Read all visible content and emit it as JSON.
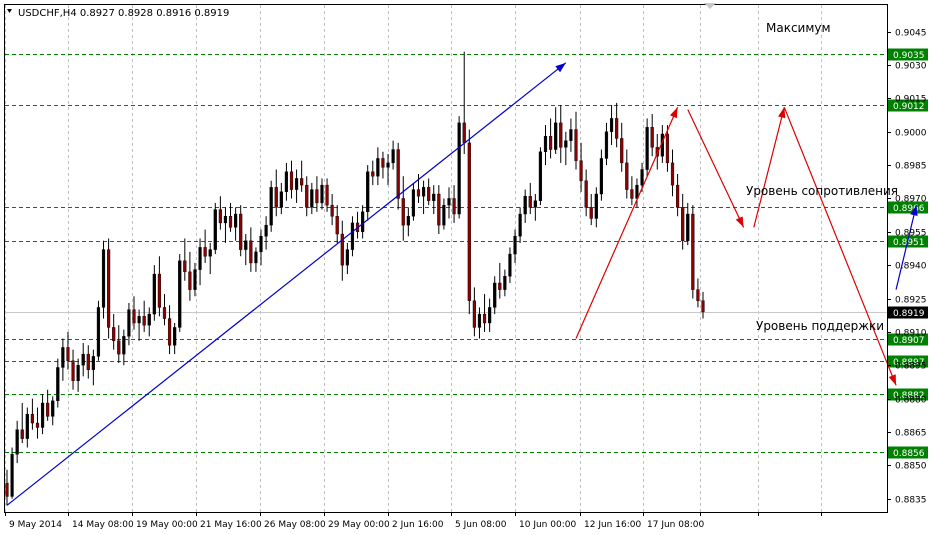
{
  "header": {
    "symbol_text": "USDCHF,H4  0.8927 0.8928 0.8916 0.8919"
  },
  "chart_data": {
    "type": "candlestick",
    "ylim": [
      0.8829,
      0.9057
    ],
    "yticks": [
      "0.9045",
      "0.9030",
      "0.9015",
      "0.9000",
      "0.8985",
      "0.8970",
      "0.8955",
      "0.8940",
      "0.8925",
      "0.8910",
      "0.8895",
      "0.8880",
      "0.8865",
      "0.8850",
      "0.8835"
    ],
    "xticks": [
      "9 May 2014",
      "14 May 08:00",
      "19 May 00:00",
      "21 May 16:00",
      "26 May 08:00",
      "29 May 00:00",
      "2 Jun 16:00",
      "5 Jun 08:00",
      "10 Jun 00:00",
      "12 Jun 16:00",
      "17 Jun 08:00"
    ],
    "levels": [
      {
        "value": "0.9035",
        "hl": false
      },
      {
        "value": "0.9012",
        "hl": true
      },
      {
        "value": "0.8966",
        "hl": false
      },
      {
        "value": "0.8951",
        "hl": true
      },
      {
        "value": "0.8907",
        "hl": true
      },
      {
        "value": "0.8897",
        "hl": false
      },
      {
        "value": "0.8882",
        "hl": false
      },
      {
        "value": "0.8856",
        "hl": false
      }
    ],
    "current_price": "0.8919",
    "annotations": [
      "Максимум",
      "Уровень сопротивления",
      "Уровень поддержки"
    ],
    "colors": {
      "bull": "#000000",
      "bear": "#8b0000",
      "level_line": "#008000",
      "level_tag": "#008000",
      "trend_blue": "#0000cc",
      "trend_red": "#dd0000",
      "grid": "#c0c0c0"
    },
    "ohlc": [
      [
        0.8842,
        0.8848,
        0.8832,
        0.8836
      ],
      [
        0.8836,
        0.8858,
        0.8835,
        0.8855
      ],
      [
        0.8855,
        0.887,
        0.8851,
        0.8866
      ],
      [
        0.8866,
        0.8878,
        0.886,
        0.8862
      ],
      [
        0.8862,
        0.8876,
        0.8858,
        0.8873
      ],
      [
        0.8873,
        0.888,
        0.8866,
        0.8869
      ],
      [
        0.8869,
        0.8876,
        0.8862,
        0.8867
      ],
      [
        0.8867,
        0.8882,
        0.8864,
        0.8878
      ],
      [
        0.8878,
        0.8884,
        0.887,
        0.8872
      ],
      [
        0.8872,
        0.8881,
        0.8868,
        0.8879
      ],
      [
        0.8879,
        0.8898,
        0.8876,
        0.8894
      ],
      [
        0.8894,
        0.8907,
        0.8888,
        0.8903
      ],
      [
        0.8903,
        0.891,
        0.8893,
        0.8897
      ],
      [
        0.8897,
        0.8902,
        0.8884,
        0.8888
      ],
      [
        0.8888,
        0.8898,
        0.8883,
        0.8895
      ],
      [
        0.8895,
        0.8905,
        0.889,
        0.89
      ],
      [
        0.89,
        0.8904,
        0.8889,
        0.8893
      ],
      [
        0.8893,
        0.8902,
        0.8886,
        0.8899
      ],
      [
        0.8899,
        0.8924,
        0.8897,
        0.8921
      ],
      [
        0.8921,
        0.8951,
        0.8916,
        0.8947
      ],
      [
        0.8947,
        0.8952,
        0.8907,
        0.8912
      ],
      [
        0.8912,
        0.8918,
        0.8902,
        0.8906
      ],
      [
        0.8906,
        0.8913,
        0.8896,
        0.89
      ],
      [
        0.89,
        0.8911,
        0.8895,
        0.8908
      ],
      [
        0.8908,
        0.8923,
        0.8904,
        0.892
      ],
      [
        0.892,
        0.8926,
        0.8911,
        0.8914
      ],
      [
        0.8914,
        0.892,
        0.8906,
        0.8917
      ],
      [
        0.8917,
        0.8924,
        0.891,
        0.8913
      ],
      [
        0.8913,
        0.8921,
        0.8908,
        0.8918
      ],
      [
        0.8918,
        0.894,
        0.8915,
        0.8936
      ],
      [
        0.8936,
        0.8944,
        0.8917,
        0.8921
      ],
      [
        0.8921,
        0.8927,
        0.8913,
        0.8916
      ],
      [
        0.8916,
        0.8922,
        0.89,
        0.8904
      ],
      [
        0.8904,
        0.8914,
        0.89,
        0.8912
      ],
      [
        0.8912,
        0.8945,
        0.891,
        0.8942
      ],
      [
        0.8942,
        0.8952,
        0.8933,
        0.8937
      ],
      [
        0.8937,
        0.8946,
        0.8924,
        0.8929
      ],
      [
        0.8929,
        0.8941,
        0.8926,
        0.8938
      ],
      [
        0.8938,
        0.8952,
        0.8931,
        0.8948
      ],
      [
        0.8948,
        0.8956,
        0.8941,
        0.8944
      ],
      [
        0.8944,
        0.895,
        0.8936,
        0.8947
      ],
      [
        0.8947,
        0.8968,
        0.8945,
        0.8965
      ],
      [
        0.8965,
        0.8971,
        0.8956,
        0.8959
      ],
      [
        0.8959,
        0.8966,
        0.895,
        0.8962
      ],
      [
        0.8962,
        0.8968,
        0.8955,
        0.8957
      ],
      [
        0.8957,
        0.8966,
        0.8951,
        0.8963
      ],
      [
        0.8963,
        0.8967,
        0.8944,
        0.8947
      ],
      [
        0.8947,
        0.8954,
        0.894,
        0.8951
      ],
      [
        0.8951,
        0.8957,
        0.8937,
        0.8941
      ],
      [
        0.8941,
        0.8948,
        0.8937,
        0.8946
      ],
      [
        0.8946,
        0.8956,
        0.894,
        0.8953
      ],
      [
        0.8953,
        0.8962,
        0.8947,
        0.8958
      ],
      [
        0.8958,
        0.8978,
        0.8955,
        0.8975
      ],
      [
        0.8975,
        0.8983,
        0.8962,
        0.8966
      ],
      [
        0.8966,
        0.8977,
        0.8963,
        0.8973
      ],
      [
        0.8973,
        0.8986,
        0.8969,
        0.8982
      ],
      [
        0.8982,
        0.8987,
        0.897,
        0.8974
      ],
      [
        0.8974,
        0.8983,
        0.8968,
        0.8979
      ],
      [
        0.8979,
        0.8987,
        0.8973,
        0.8976
      ],
      [
        0.8976,
        0.898,
        0.8962,
        0.8966
      ],
      [
        0.8966,
        0.8977,
        0.8963,
        0.8974
      ],
      [
        0.8974,
        0.898,
        0.8964,
        0.8968
      ],
      [
        0.8968,
        0.8979,
        0.8965,
        0.8976
      ],
      [
        0.8976,
        0.8979,
        0.8964,
        0.8967
      ],
      [
        0.8967,
        0.8972,
        0.8958,
        0.8962
      ],
      [
        0.8962,
        0.8967,
        0.895,
        0.8954
      ],
      [
        0.8954,
        0.896,
        0.8933,
        0.894
      ],
      [
        0.894,
        0.895,
        0.8936,
        0.8947
      ],
      [
        0.8947,
        0.8962,
        0.8944,
        0.8959
      ],
      [
        0.8959,
        0.8964,
        0.8952,
        0.8955
      ],
      [
        0.8955,
        0.8967,
        0.8952,
        0.8964
      ],
      [
        0.8964,
        0.8985,
        0.896,
        0.8982
      ],
      [
        0.8982,
        0.8987,
        0.8976,
        0.898
      ],
      [
        0.898,
        0.8993,
        0.8976,
        0.8988
      ],
      [
        0.8988,
        0.8991,
        0.8979,
        0.8984
      ],
      [
        0.8984,
        0.899,
        0.8976,
        0.8986
      ],
      [
        0.8986,
        0.8996,
        0.8983,
        0.8992
      ],
      [
        0.8992,
        0.8995,
        0.8965,
        0.897
      ],
      [
        0.897,
        0.898,
        0.8951,
        0.8958
      ],
      [
        0.8958,
        0.8966,
        0.8953,
        0.8962
      ],
      [
        0.8962,
        0.8977,
        0.896,
        0.8974
      ],
      [
        0.8974,
        0.8981,
        0.8968,
        0.8971
      ],
      [
        0.8971,
        0.8978,
        0.8963,
        0.8975
      ],
      [
        0.8975,
        0.8979,
        0.8967,
        0.8969
      ],
      [
        0.8969,
        0.8976,
        0.8963,
        0.8972
      ],
      [
        0.8972,
        0.8976,
        0.8954,
        0.8958
      ],
      [
        0.8958,
        0.897,
        0.8956,
        0.8967
      ],
      [
        0.8967,
        0.8975,
        0.8961,
        0.897
      ],
      [
        0.897,
        0.8976,
        0.8959,
        0.8963
      ],
      [
        0.8963,
        0.9007,
        0.8961,
        0.9004
      ],
      [
        0.9004,
        0.9036,
        0.899,
        0.8995
      ],
      [
        0.8995,
        0.9001,
        0.8918,
        0.8924
      ],
      [
        0.8924,
        0.893,
        0.8908,
        0.8912
      ],
      [
        0.8912,
        0.8921,
        0.8907,
        0.8918
      ],
      [
        0.8918,
        0.8927,
        0.891,
        0.8914
      ],
      [
        0.8914,
        0.8925,
        0.891,
        0.8921
      ],
      [
        0.8921,
        0.8935,
        0.8918,
        0.8932
      ],
      [
        0.8932,
        0.8941,
        0.8925,
        0.8929
      ],
      [
        0.8929,
        0.8938,
        0.8926,
        0.8935
      ],
      [
        0.8935,
        0.8948,
        0.8932,
        0.8945
      ],
      [
        0.8945,
        0.8956,
        0.8941,
        0.8953
      ],
      [
        0.8953,
        0.8966,
        0.895,
        0.8963
      ],
      [
        0.8963,
        0.8974,
        0.8959,
        0.8971
      ],
      [
        0.8971,
        0.8977,
        0.8963,
        0.8966
      ],
      [
        0.8966,
        0.8972,
        0.896,
        0.8969
      ],
      [
        0.8969,
        0.8993,
        0.8967,
        0.8991
      ],
      [
        0.8991,
        0.9003,
        0.8985,
        0.8998
      ],
      [
        0.8998,
        0.9006,
        0.8988,
        0.8992
      ],
      [
        0.8992,
        0.9011,
        0.899,
        0.9004
      ],
      [
        0.9004,
        0.9012,
        0.8986,
        0.8993
      ],
      [
        0.8993,
        0.9,
        0.8985,
        0.8996
      ],
      [
        0.8996,
        0.9006,
        0.8991,
        0.9001
      ],
      [
        0.9001,
        0.9009,
        0.8983,
        0.8987
      ],
      [
        0.8987,
        0.8995,
        0.8973,
        0.8978
      ],
      [
        0.8978,
        0.8983,
        0.8962,
        0.8966
      ],
      [
        0.8966,
        0.8972,
        0.8958,
        0.8961
      ],
      [
        0.8961,
        0.8975,
        0.8957,
        0.8972
      ],
      [
        0.8972,
        0.8992,
        0.8969,
        0.8988
      ],
      [
        0.8988,
        0.9004,
        0.8985,
        0.9
      ],
      [
        0.9,
        0.9012,
        0.8994,
        0.9006
      ],
      [
        0.9006,
        0.9013,
        0.8993,
        0.8997
      ],
      [
        0.8997,
        0.9004,
        0.8982,
        0.8986
      ],
      [
        0.8986,
        0.8992,
        0.897,
        0.8974
      ],
      [
        0.8974,
        0.898,
        0.8967,
        0.897
      ],
      [
        0.897,
        0.8979,
        0.8966,
        0.8976
      ],
      [
        0.8976,
        0.8986,
        0.8973,
        0.8983
      ],
      [
        0.8983,
        0.9006,
        0.898,
        0.9002
      ],
      [
        0.9002,
        0.9008,
        0.8989,
        0.8993
      ],
      [
        0.8993,
        0.8999,
        0.8983,
        0.8989
      ],
      [
        0.8989,
        0.9003,
        0.8986,
        0.8999
      ],
      [
        0.8999,
        0.9003,
        0.8982,
        0.8986
      ],
      [
        0.8986,
        0.8992,
        0.8971,
        0.8976
      ],
      [
        0.8976,
        0.8981,
        0.8962,
        0.8966
      ],
      [
        0.8966,
        0.8972,
        0.8947,
        0.8951
      ],
      [
        0.8951,
        0.8968,
        0.8949,
        0.8963
      ],
      [
        0.8963,
        0.8967,
        0.8925,
        0.8929
      ],
      [
        0.8929,
        0.8934,
        0.8921,
        0.8924
      ],
      [
        0.8924,
        0.8928,
        0.8916,
        0.8919
      ]
    ],
    "trendlines": [
      {
        "color": "blue",
        "x1": 0,
        "y1": 0.8832,
        "x2": 110,
        "y2": 0.9031,
        "arrow": true
      },
      {
        "color": "red",
        "x1": 112,
        "y1": 0.8907,
        "x2": 132,
        "y2": 0.9011,
        "arrow": true
      },
      {
        "color": "red",
        "x1": 134,
        "y1": 0.901,
        "x2": 145,
        "y2": 0.8957,
        "arrow": true
      },
      {
        "color": "red",
        "x1": 147,
        "y1": 0.8957,
        "x2": 153,
        "y2": 0.9011,
        "arrow": true
      },
      {
        "color": "red",
        "x1": 153,
        "y1": 0.9011,
        "x2": 175,
        "y2": 0.8886,
        "arrow": true
      },
      {
        "color": "blue",
        "x1": 175,
        "y1": 0.8929,
        "x2": 179,
        "y2": 0.8967,
        "arrow": true
      }
    ]
  }
}
